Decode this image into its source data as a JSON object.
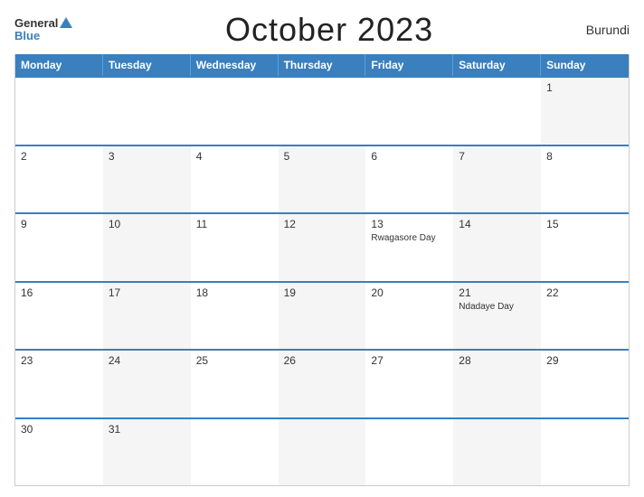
{
  "header": {
    "title": "October 2023",
    "country": "Burundi",
    "logo_general": "General",
    "logo_blue": "Blue"
  },
  "days_of_week": [
    "Monday",
    "Tuesday",
    "Wednesday",
    "Thursday",
    "Friday",
    "Saturday",
    "Sunday"
  ],
  "weeks": [
    [
      {
        "num": "",
        "event": "",
        "gray": false
      },
      {
        "num": "",
        "event": "",
        "gray": false
      },
      {
        "num": "",
        "event": "",
        "gray": false
      },
      {
        "num": "",
        "event": "",
        "gray": false
      },
      {
        "num": "",
        "event": "",
        "gray": false
      },
      {
        "num": "",
        "event": "",
        "gray": false
      },
      {
        "num": "1",
        "event": "",
        "gray": true
      }
    ],
    [
      {
        "num": "2",
        "event": "",
        "gray": false
      },
      {
        "num": "3",
        "event": "",
        "gray": true
      },
      {
        "num": "4",
        "event": "",
        "gray": false
      },
      {
        "num": "5",
        "event": "",
        "gray": true
      },
      {
        "num": "6",
        "event": "",
        "gray": false
      },
      {
        "num": "7",
        "event": "",
        "gray": true
      },
      {
        "num": "8",
        "event": "",
        "gray": false
      }
    ],
    [
      {
        "num": "9",
        "event": "",
        "gray": false
      },
      {
        "num": "10",
        "event": "",
        "gray": true
      },
      {
        "num": "11",
        "event": "",
        "gray": false
      },
      {
        "num": "12",
        "event": "",
        "gray": true
      },
      {
        "num": "13",
        "event": "Rwagasore Day",
        "gray": false
      },
      {
        "num": "14",
        "event": "",
        "gray": true
      },
      {
        "num": "15",
        "event": "",
        "gray": false
      }
    ],
    [
      {
        "num": "16",
        "event": "",
        "gray": false
      },
      {
        "num": "17",
        "event": "",
        "gray": true
      },
      {
        "num": "18",
        "event": "",
        "gray": false
      },
      {
        "num": "19",
        "event": "",
        "gray": true
      },
      {
        "num": "20",
        "event": "",
        "gray": false
      },
      {
        "num": "21",
        "event": "Ndadaye Day",
        "gray": true
      },
      {
        "num": "22",
        "event": "",
        "gray": false
      }
    ],
    [
      {
        "num": "23",
        "event": "",
        "gray": false
      },
      {
        "num": "24",
        "event": "",
        "gray": true
      },
      {
        "num": "25",
        "event": "",
        "gray": false
      },
      {
        "num": "26",
        "event": "",
        "gray": true
      },
      {
        "num": "27",
        "event": "",
        "gray": false
      },
      {
        "num": "28",
        "event": "",
        "gray": true
      },
      {
        "num": "29",
        "event": "",
        "gray": false
      }
    ],
    [
      {
        "num": "30",
        "event": "",
        "gray": false
      },
      {
        "num": "31",
        "event": "",
        "gray": true
      },
      {
        "num": "",
        "event": "",
        "gray": false
      },
      {
        "num": "",
        "event": "",
        "gray": true
      },
      {
        "num": "",
        "event": "",
        "gray": false
      },
      {
        "num": "",
        "event": "",
        "gray": true
      },
      {
        "num": "",
        "event": "",
        "gray": false
      }
    ]
  ]
}
